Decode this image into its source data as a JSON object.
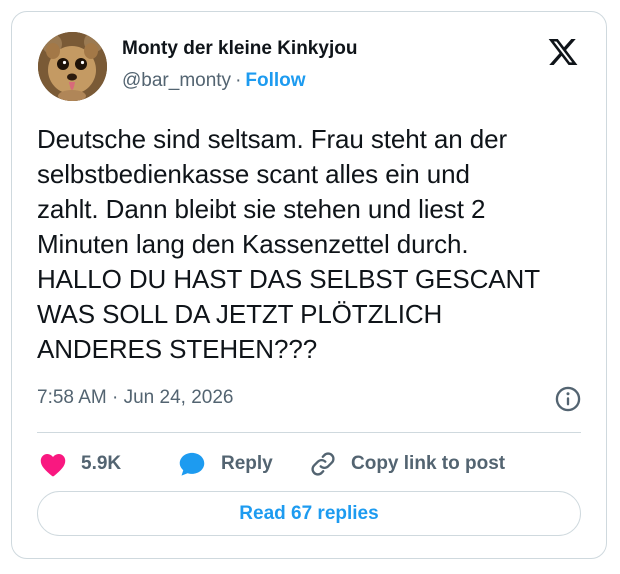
{
  "author": {
    "display_name": "Monty der kleine Kinkyjou",
    "handle": "@bar_monty",
    "separator": "·",
    "follow_label": "Follow"
  },
  "logo_icon": "x-logo-icon",
  "tweet": {
    "lines": [
      "Deutsche sind seltsam. Frau steht an der",
      "selbstbedienkasse scant alles ein und",
      "zahlt. Dann bleibt sie stehen und liest 2",
      "Minuten lang den Kassenzettel durch.",
      "HALLO DU HAST DAS SELBST GESCANT",
      "WAS SOLL DA JETZT PLÖTZLICH",
      "ANDERES STEHEN???"
    ],
    "timestamp": "7:58 AM · Jun 24, 2026"
  },
  "actions": {
    "likes_count": "5.9K",
    "reply_label": "Reply",
    "copy_link_label": "Copy link to post"
  },
  "read_replies_label": "Read 67 replies",
  "colors": {
    "accent": "#1d9bf0",
    "heart": "#f91880",
    "text": "#0f1419",
    "muted": "#536471",
    "border": "#cfd9de"
  }
}
